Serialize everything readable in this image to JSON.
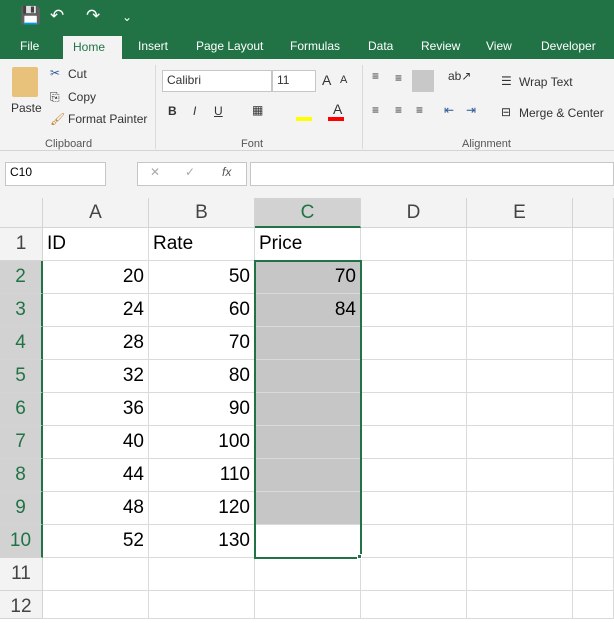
{
  "qat": {
    "save": "💾",
    "undo": "↶",
    "redo": "↷",
    "more": "⌄"
  },
  "tabs": [
    "File",
    "Home",
    "Insert",
    "Page Layout",
    "Formulas",
    "Data",
    "Review",
    "View",
    "Developer"
  ],
  "ribbon": {
    "paste": "Paste",
    "cut": "Cut",
    "copy": "Copy",
    "format_painter": "Format Painter",
    "clipboard": "Clipboard",
    "font_name": "Calibri",
    "font_size": "11",
    "bold": "B",
    "italic": "I",
    "underline": "U",
    "font": "Font",
    "wrap_text": "Wrap Text",
    "merge_center": "Merge & Center",
    "alignment": "Alignment",
    "fill_color": "#ffff00",
    "font_color": "#ff0000"
  },
  "formula_bar": {
    "name_box": "C10",
    "fx": "fx",
    "cancel": "✕",
    "enter": "✓",
    "value": ""
  },
  "columns": [
    "A",
    "B",
    "C",
    "D",
    "E"
  ],
  "rows": [
    "1",
    "2",
    "3",
    "4",
    "5",
    "6",
    "7",
    "8",
    "9",
    "10",
    "11",
    "12"
  ],
  "cells": [
    [
      "ID",
      "Rate",
      "Price"
    ],
    [
      "20",
      "50",
      "70"
    ],
    [
      "24",
      "60",
      "84"
    ],
    [
      "28",
      "70",
      ""
    ],
    [
      "32",
      "80",
      ""
    ],
    [
      "36",
      "90",
      ""
    ],
    [
      "40",
      "100",
      ""
    ],
    [
      "44",
      "110",
      ""
    ],
    [
      "48",
      "120",
      ""
    ],
    [
      "52",
      "130",
      ""
    ]
  ],
  "accent": "#217346"
}
